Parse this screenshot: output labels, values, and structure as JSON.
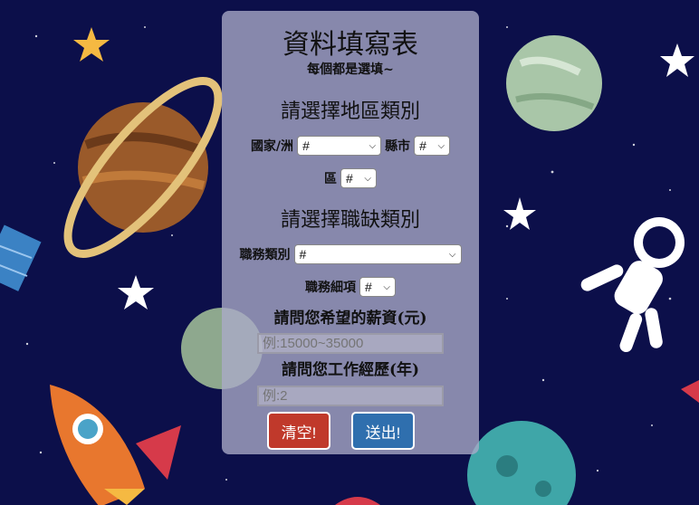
{
  "form": {
    "title": "資料填寫表",
    "subtitle": "每個都是選填~",
    "region_heading": "請選擇地區類別",
    "country_label": "國家/洲",
    "country_value": "#",
    "city_label": "縣市",
    "city_value": "#",
    "district_label": "區",
    "district_value": "#",
    "job_heading": "請選擇職缺類別",
    "job_category_label": "職務類別",
    "job_category_value": "#",
    "job_detail_label": "職務細項",
    "job_detail_value": "#",
    "salary_question": "請問您希望的薪資(元)",
    "salary_placeholder": "例:15000~35000",
    "experience_question": "請問您工作經歷(年)",
    "experience_placeholder": "例:2",
    "clear_label": "清空!",
    "submit_label": "送出!"
  },
  "colors": {
    "background": "#0c0f4a",
    "clear_button": "#c0392b",
    "submit_button": "#2f6fae"
  }
}
